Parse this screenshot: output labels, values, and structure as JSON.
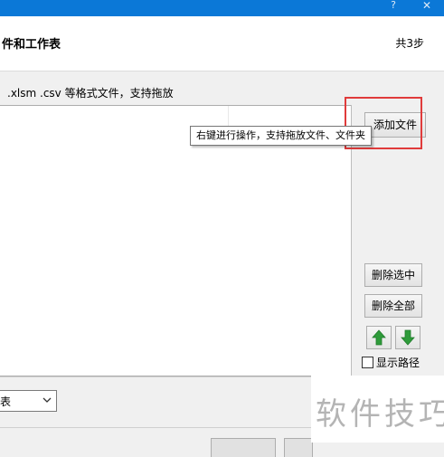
{
  "titlebar": {
    "help_glyph": "?",
    "close_glyph": "✕"
  },
  "header": {
    "title": "件和工作表",
    "step": "共3步"
  },
  "instruction": ".xlsm .csv 等格式文件，支持拖放",
  "tooltip": "右键进行操作，支持拖放文件、文件夹",
  "buttons": {
    "add_file": "添加文件",
    "delete_selected": "删除选中",
    "delete_all": "删除全部"
  },
  "icons": {
    "up": "arrow-up",
    "down": "arrow-down",
    "arrow_color": "#2e9b3a"
  },
  "show_path": {
    "label": "显示路径",
    "checked": false
  },
  "select": {
    "value": "表"
  },
  "watermark": "软件技巧",
  "colors": {
    "titlebar": "#0b78d7",
    "highlight": "#e03b3b",
    "background": "#f0f0f0"
  }
}
